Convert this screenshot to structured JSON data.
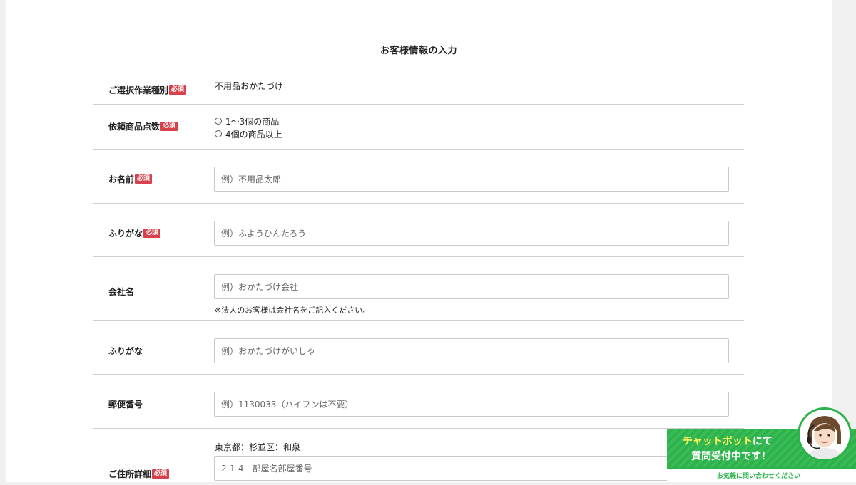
{
  "form": {
    "title": "お客様情報の入力",
    "required_badge": "必須",
    "rows": {
      "work_type": {
        "label": "ご選択作業種別",
        "value": "不用品おかたづけ"
      },
      "item_count": {
        "label": "依頼商品点数",
        "options": [
          "1〜3個の商品",
          "4個の商品以上"
        ]
      },
      "name": {
        "label": "お名前",
        "placeholder": "例）不用品太郎"
      },
      "name_kana": {
        "label": "ふりがな",
        "placeholder": "例）ふようひんたろう"
      },
      "company": {
        "label": "会社名",
        "placeholder": "例）おかたづけ会社",
        "note": "※法人のお客様は会社名をご記入ください。"
      },
      "company_kana": {
        "label": "ふりがな",
        "placeholder": "例）おかたづけがいしゃ"
      },
      "postal_code": {
        "label": "郵便番号",
        "placeholder": "例）1130033（ハイフンは不要）"
      },
      "address": {
        "label": "ご住所詳細",
        "prefilled": "東京都：杉並区：和泉",
        "placeholder": "2-1-4　部屋名部屋番号"
      }
    }
  },
  "chatbot": {
    "line1_highlight": "チャットボット",
    "line1_rest": "にて",
    "line2": "質問受付中です！",
    "sub": "お気軽に問い合わせください",
    "accent_color": "#2bb34a"
  }
}
